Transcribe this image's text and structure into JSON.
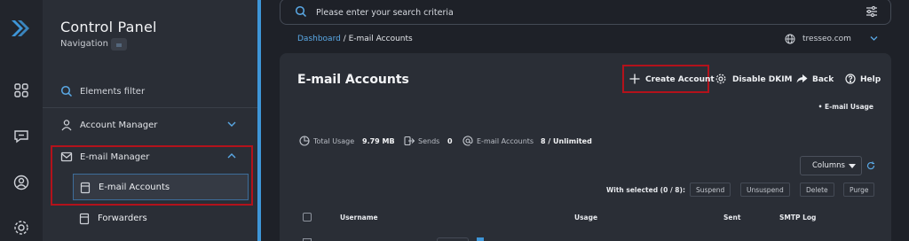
{
  "nav": {
    "title": "Control Panel",
    "subtitle": "Navigation",
    "filter_label": "Elements filter",
    "items": [
      {
        "label": "Account Manager"
      },
      {
        "label": "E-mail Manager"
      }
    ],
    "sub_items": [
      {
        "label": "E-mail Accounts"
      },
      {
        "label": "Forwarders"
      }
    ]
  },
  "search": {
    "placeholder": "Please enter your search criteria"
  },
  "breadcrumb": {
    "parent": "Dashboard",
    "current": "E-mail Accounts"
  },
  "domain": "tresseo.com",
  "panel": {
    "title": "E-mail Accounts",
    "toolbar": {
      "create": "Create Account",
      "dkim": "Disable DKIM",
      "back": "Back",
      "help": "Help"
    },
    "usage_link": "• E-mail Usage",
    "stats": {
      "total_usage_label": "Total Usage",
      "total_usage_value": "9.79 MB",
      "sends_label": "Sends",
      "sends_value": "0",
      "accounts_label": "E-mail Accounts",
      "accounts_value": "8 / Unlimited"
    },
    "columns_label": "Columns",
    "with_selected": "With selected (0 / 8):",
    "bulk_actions": [
      "Suspend",
      "Unsuspend",
      "Delete",
      "Purge"
    ],
    "table_headers": [
      "Username",
      "Usage",
      "Sent",
      "SMTP Log"
    ]
  },
  "colors": {
    "accent": "#3e96d8",
    "highlight": "#b3121b",
    "background": "#1e2128",
    "panel": "#2a2e36"
  }
}
